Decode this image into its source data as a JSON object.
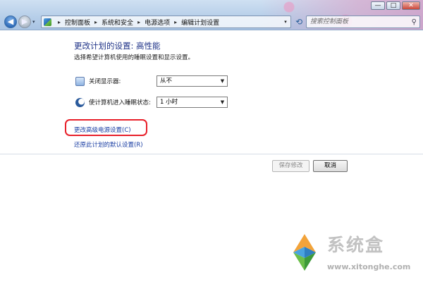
{
  "window": {
    "controls": {
      "minimize": "—",
      "maximize": "□",
      "close": "✕"
    }
  },
  "nav": {
    "back_icon": "back-arrow-icon",
    "forward_icon": "forward-arrow-icon",
    "dropdown_glyph": "▾"
  },
  "address": {
    "breadcrumbs": [
      "控制面板",
      "系统和安全",
      "电源选项",
      "编辑计划设置"
    ],
    "separator": "▸",
    "dropdown_glyph": "▾"
  },
  "search": {
    "placeholder": "搜索控制面板"
  },
  "page": {
    "title": "更改计划的设置: 高性能",
    "subtitle": "选择希望计算机使用的睡眠设置和显示设置。"
  },
  "settings": {
    "display": {
      "label": "关闭显示器:",
      "value": "从不",
      "icon": "monitor-icon"
    },
    "sleep": {
      "label": "使计算机进入睡眠状态:",
      "value": "1 小时",
      "icon": "moon-icon"
    }
  },
  "links": {
    "advanced": "更改高级电源设置(C)",
    "restore": "还原此计划的默认设置(R)"
  },
  "buttons": {
    "save": "保存修改",
    "cancel": "取消"
  },
  "watermark": {
    "text": "系统盒",
    "url": "www.xitonghe.com"
  },
  "colors": {
    "title": "#1e3287",
    "link": "#1a3ea3",
    "annotation": "#e8202a",
    "titlebar": "#b7cfe9"
  }
}
